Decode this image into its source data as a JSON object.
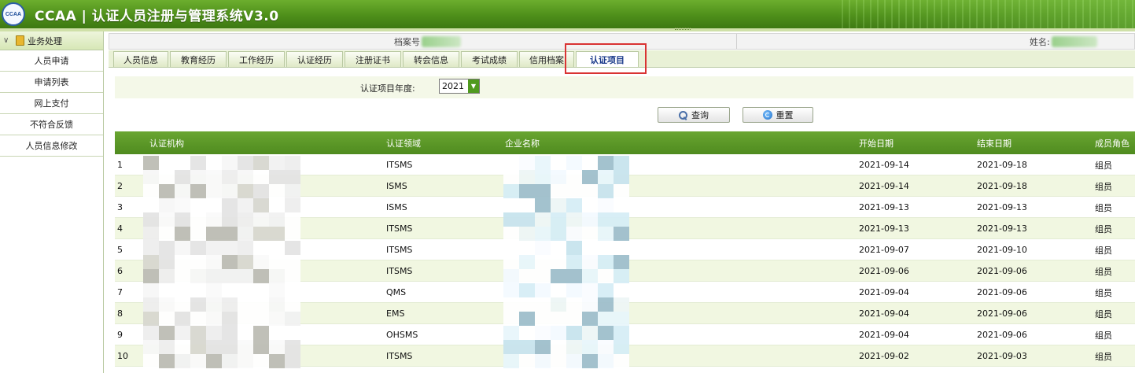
{
  "header": {
    "logo_text": "CCAA",
    "title": "CCAA | 认证人员注册与管理系统V3.0"
  },
  "sidebar": {
    "section_label": "业务处理",
    "items": [
      {
        "label": "人员申请"
      },
      {
        "label": "申请列表"
      },
      {
        "label": "网上支付"
      },
      {
        "label": "不符合反馈"
      },
      {
        "label": "人员信息修改"
      }
    ]
  },
  "info_bar": {
    "file_no_label": "档案号",
    "name_label": "姓名:"
  },
  "tabs": [
    {
      "label": "人员信息"
    },
    {
      "label": "教育经历"
    },
    {
      "label": "工作经历"
    },
    {
      "label": "认证经历"
    },
    {
      "label": "注册证书"
    },
    {
      "label": "转会信息"
    },
    {
      "label": "考试成绩"
    },
    {
      "label": "信用档案"
    },
    {
      "label": "认证项目"
    }
  ],
  "active_tab": "认证项目",
  "filter": {
    "year_label": "认证项目年度:",
    "year_value": "2021"
  },
  "buttons": {
    "query": "查询",
    "reset": "重置"
  },
  "table": {
    "columns": [
      "认证机构",
      "认证领域",
      "企业名称",
      "开始日期",
      "结束日期",
      "成员角色"
    ],
    "rows": [
      {
        "no": "1",
        "field": "ITSMS",
        "start": "2021-09-14",
        "end": "2021-09-18",
        "role": "组员"
      },
      {
        "no": "2",
        "field": "ISMS",
        "start": "2021-09-14",
        "end": "2021-09-18",
        "role": "组员"
      },
      {
        "no": "3",
        "field": "ISMS",
        "start": "2021-09-13",
        "end": "2021-09-13",
        "role": "组员"
      },
      {
        "no": "4",
        "field": "ITSMS",
        "start": "2021-09-13",
        "end": "2021-09-13",
        "role": "组员"
      },
      {
        "no": "5",
        "field": "ITSMS",
        "start": "2021-09-07",
        "end": "2021-09-10",
        "role": "组员"
      },
      {
        "no": "6",
        "field": "ITSMS",
        "start": "2021-09-06",
        "end": "2021-09-06",
        "role": "组员"
      },
      {
        "no": "7",
        "field": "QMS",
        "start": "2021-09-04",
        "end": "2021-09-06",
        "role": "组员"
      },
      {
        "no": "8",
        "field": "EMS",
        "start": "2021-09-04",
        "end": "2021-09-06",
        "role": "组员"
      },
      {
        "no": "9",
        "field": "OHSMS",
        "start": "2021-09-04",
        "end": "2021-09-06",
        "role": "组员"
      },
      {
        "no": "10",
        "field": "ITSMS",
        "start": "2021-09-02",
        "end": "2021-09-03",
        "role": "组员"
      }
    ]
  },
  "colors": {
    "header_green": "#4e8f1a",
    "table_header_green": "#5a9626",
    "highlight_red": "#d93333"
  }
}
